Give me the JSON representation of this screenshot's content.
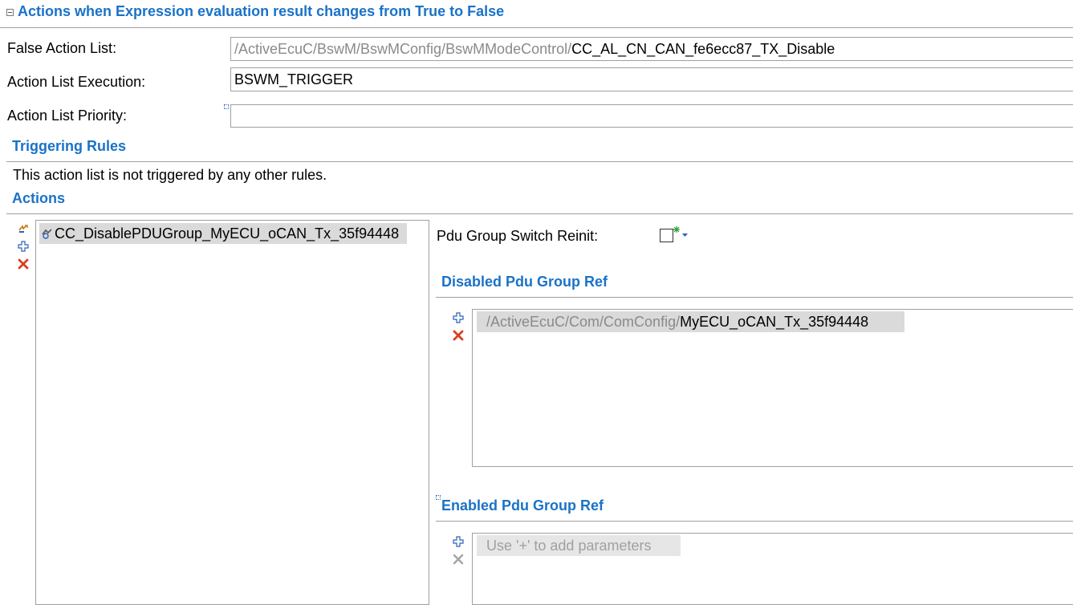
{
  "section": {
    "title": "Actions when Expression evaluation result changes from True to False"
  },
  "form": {
    "false_action_list": {
      "label": "False Action List:",
      "path_prefix": "/ActiveEcuC/BswM/BswMConfig/BswMModeControl/",
      "value": "CC_AL_CN_CAN_fe6ecc87_TX_Disable"
    },
    "action_list_execution": {
      "label": "Action List Execution:",
      "value": "BSWM_TRIGGER"
    },
    "action_list_priority": {
      "label": "Action List Priority:",
      "value": ""
    }
  },
  "triggering_rules": {
    "title": "Triggering Rules",
    "message": "This action list is not triggered by any other rules."
  },
  "actions": {
    "title": "Actions",
    "items": [
      {
        "label": "CC_DisablePDUGroup_MyECU_oCAN_Tx_35f94448"
      }
    ]
  },
  "details": {
    "pdu_group_switch_reinit": {
      "label": "Pdu Group Switch Reinit:",
      "checked": false
    },
    "disabled_pdu_group_ref": {
      "title": "Disabled Pdu Group Ref",
      "items": [
        {
          "path_prefix": "/ActiveEcuC/Com/ComConfig/",
          "value": "MyECU_oCAN_Tx_35f94448"
        }
      ]
    },
    "enabled_pdu_group_ref": {
      "title": "Enabled Pdu Group Ref",
      "placeholder": "Use '+' to add parameters"
    }
  },
  "colors": {
    "header_blue": "#1a72c7",
    "delete_red": "#d9401f",
    "add_blue": "#2a62b8",
    "path_gray": "#8a8a8a",
    "selection_gray": "#dadada"
  },
  "icons": {
    "collapse": "collapse-icon",
    "action_type": "action-type-icon",
    "add": "add-icon",
    "delete": "delete-icon",
    "add_item": "plus-icon",
    "remove_item": "x-icon",
    "info": "info-marker-icon",
    "default_value": "default-indicator-icon",
    "dropdown": "dropdown-arrow-icon"
  }
}
